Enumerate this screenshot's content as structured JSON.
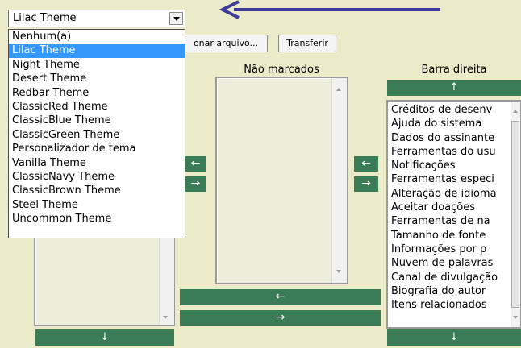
{
  "theme_select": {
    "selected": "Lilac Theme",
    "options": [
      "Nenhum(a)",
      "Lilac Theme",
      "Night Theme",
      "Desert Theme",
      "Redbar Theme",
      "ClassicRed Theme",
      "ClassicBlue Theme",
      "ClassicGreen Theme",
      "Personalizador de tema",
      "Vanilla Theme",
      "ClassicNavy Theme",
      "ClassicBrown Theme",
      "Steel Theme",
      "Uncommon Theme"
    ]
  },
  "toolbar": {
    "choose_file_label": "onar arquivo...",
    "transfer_label": "Transferir"
  },
  "columns": {
    "unmarked_header": "Não marcados",
    "right_bar_header": "Barra direita"
  },
  "right_bar_items": [
    "Créditos de desenv",
    "Ajuda do sistema",
    "Dados do assinante",
    "Ferramentas do usu",
    "Notificações",
    "Ferramentas especi",
    "Alteração de idioma",
    "Aceitar doações",
    "Ferramentas de na",
    "Tamanho de fonte",
    "Informações por p",
    "Nuvem de palavras",
    "Canal de divulgação",
    "Biografia do autor",
    "Itens relacionados"
  ],
  "arrows": {
    "up": "↑",
    "down": "↓",
    "left": "←",
    "right": "→"
  },
  "colors": {
    "background": "#ebebc9",
    "green_button": "#3a7c55",
    "selection": "#3399ff",
    "annotation_arrow": "#3c3c9a"
  }
}
